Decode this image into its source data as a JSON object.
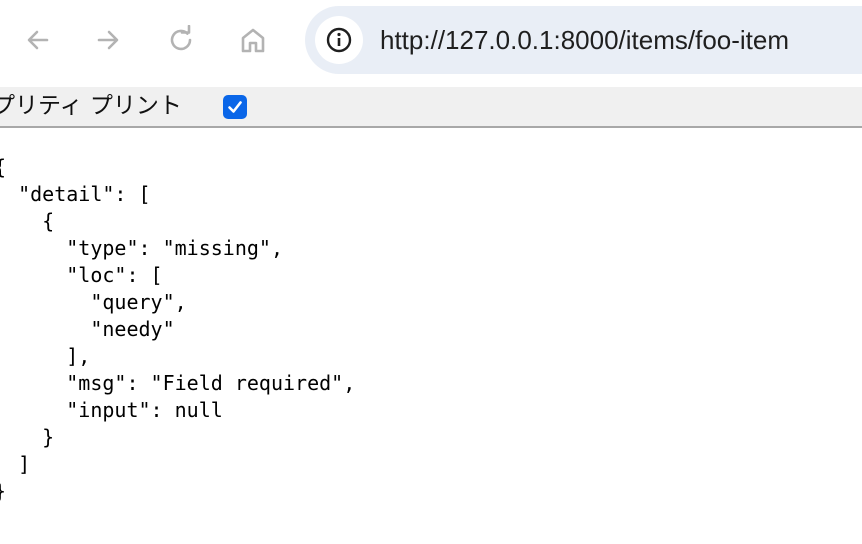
{
  "browser": {
    "url": "http://127.0.0.1:8000/items/foo-item",
    "icons": {
      "back": "arrow-left-icon",
      "forward": "arrow-right-icon",
      "reload": "reload-icon",
      "home": "home-icon",
      "site_info": "info-icon"
    }
  },
  "pretty_print": {
    "label": "プリティ プリント",
    "checked": true,
    "accent_color": "#0a66e8"
  },
  "json_lines": [
    "{",
    "  \"detail\": [",
    "    {",
    "      \"type\": \"missing\",",
    "      \"loc\": [",
    "        \"query\",",
    "        \"needy\"",
    "      ],",
    "      \"msg\": \"Field required\",",
    "      \"input\": null",
    "    }",
    "  ]",
    "}"
  ]
}
